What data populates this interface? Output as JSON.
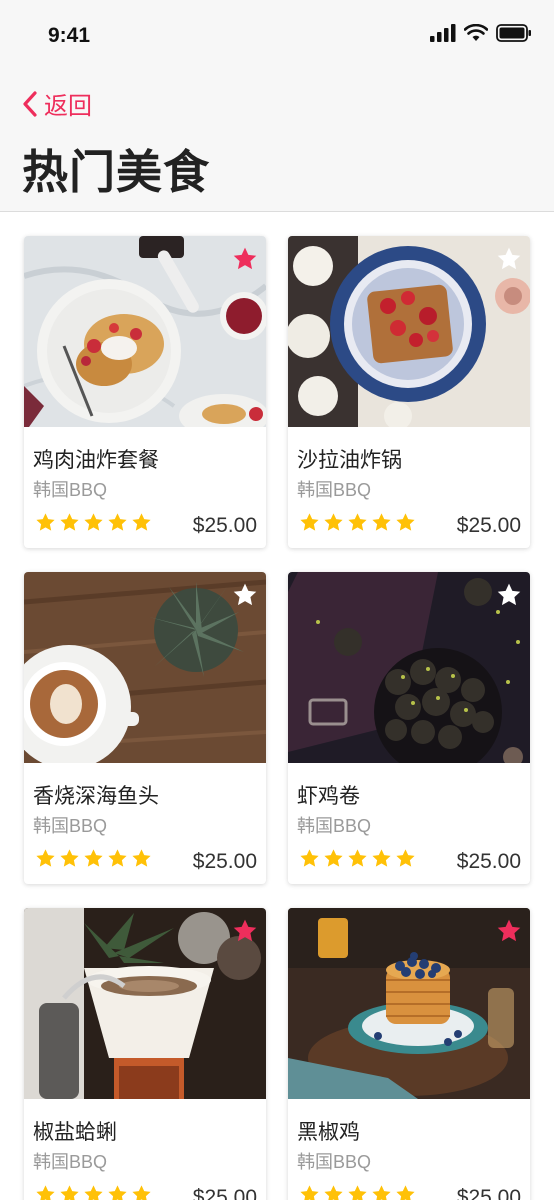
{
  "status_bar": {
    "time": "9:41"
  },
  "nav": {
    "back_label": "返回",
    "title": "热门美食"
  },
  "colors": {
    "accent": "#ee2e5c",
    "star": "#ffc107",
    "fav_on": "#ee2e5c",
    "fav_off": "#ffffff"
  },
  "items": [
    {
      "name": "鸡肉油炸套餐",
      "subtitle": "韩国BBQ",
      "price": "$25.00",
      "rating": 5,
      "favorite": true,
      "image": "pancakes-with-jam-photo"
    },
    {
      "name": "沙拉油炸锅",
      "subtitle": "韩国BBQ",
      "price": "$25.00",
      "rating": 5,
      "favorite": false,
      "image": "strawberry-toast-photo"
    },
    {
      "name": "香烧深海鱼头",
      "subtitle": "韩国BBQ",
      "price": "$25.00",
      "rating": 5,
      "favorite": false,
      "image": "latte-and-succulent-photo"
    },
    {
      "name": "虾鸡卷",
      "subtitle": "韩国BBQ",
      "price": "$25.00",
      "rating": 5,
      "favorite": false,
      "image": "energy-balls-photo"
    },
    {
      "name": "椒盐蛤蜊",
      "subtitle": "韩国BBQ",
      "price": "$25.00",
      "rating": 5,
      "favorite": true,
      "image": "pour-over-coffee-photo"
    },
    {
      "name": "黑椒鸡",
      "subtitle": "韩国BBQ",
      "price": "$25.00",
      "rating": 5,
      "favorite": true,
      "image": "blueberry-pancakes-photo"
    }
  ]
}
